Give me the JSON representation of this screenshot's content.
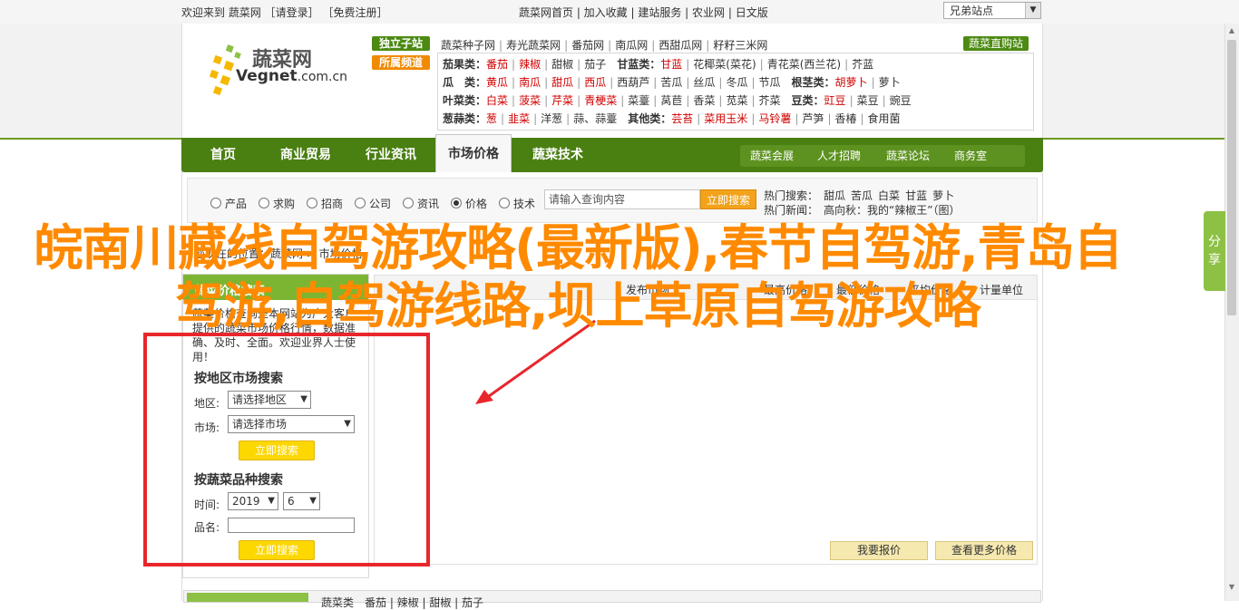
{
  "topbar": {
    "welcome": "欢迎来到 蔬菜网 ［请登录］ ［免费注册］",
    "links": "蔬菜网首页 | 加入收藏 | 建站服务 | 农业网 | 日文版",
    "select_value": "兄弟站点"
  },
  "logo": {
    "cn": "蔬菜网",
    "en": "Vegnet",
    "domain": ".com.cn",
    "reg": "®"
  },
  "tags": {
    "seed": "独立子站",
    "channel": "所属频道",
    "direct": "蔬菜直购站"
  },
  "seed_sites": [
    "蔬菜种子网",
    "寿光蔬菜网",
    "番茄网",
    "南瓜网",
    "西甜瓜网",
    "籽籽三米网"
  ],
  "categories": [
    {
      "label": "茄果类：",
      "items": [
        {
          "t": "番茄",
          "r": true
        },
        {
          "t": "辣椒",
          "r": true
        },
        {
          "t": "甜椒",
          "r": false
        },
        {
          "t": "茄子",
          "r": false
        }
      ],
      "label2": "甘蓝类：",
      "items2": [
        {
          "t": "甘蓝",
          "r": true
        },
        {
          "t": "花椰菜(菜花)",
          "r": false
        },
        {
          "t": "青花菜(西兰花)",
          "r": false
        },
        {
          "t": "芥蓝",
          "r": false
        }
      ]
    },
    {
      "label": "瓜　类：",
      "items": [
        {
          "t": "黄瓜",
          "r": true
        },
        {
          "t": "南瓜",
          "r": true
        },
        {
          "t": "甜瓜",
          "r": true
        },
        {
          "t": "西瓜",
          "r": true
        },
        {
          "t": "西葫芦",
          "r": false
        },
        {
          "t": "苦瓜",
          "r": false
        },
        {
          "t": "丝瓜",
          "r": false
        },
        {
          "t": "冬瓜",
          "r": false
        },
        {
          "t": "节瓜",
          "r": false
        }
      ],
      "label2": "根茎类：",
      "items2": [
        {
          "t": "胡萝卜",
          "r": true
        },
        {
          "t": "萝卜",
          "r": false
        }
      ]
    },
    {
      "label": "叶菜类：",
      "items": [
        {
          "t": "白菜",
          "r": true
        },
        {
          "t": "菠菜",
          "r": true
        },
        {
          "t": "芹菜",
          "r": true
        },
        {
          "t": "青梗菜",
          "r": true
        },
        {
          "t": "菜薹",
          "r": false
        },
        {
          "t": "莴苣",
          "r": false
        },
        {
          "t": "香菜",
          "r": false
        },
        {
          "t": "苋菜",
          "r": false
        },
        {
          "t": "芥菜",
          "r": false
        }
      ],
      "label2": "豆类：",
      "items2": [
        {
          "t": "豇豆",
          "r": true
        },
        {
          "t": "菜豆",
          "r": false
        },
        {
          "t": "豌豆",
          "r": false
        }
      ]
    },
    {
      "label": "葱蒜类：",
      "items": [
        {
          "t": "葱",
          "r": true
        },
        {
          "t": "韭菜",
          "r": true
        },
        {
          "t": "洋葱",
          "r": false
        },
        {
          "t": "蒜、蒜薹",
          "r": false
        }
      ],
      "label2": "其他类：",
      "items2": [
        {
          "t": "芸苔",
          "r": true
        },
        {
          "t": "菜用玉米",
          "r": true
        },
        {
          "t": "马铃薯",
          "r": true
        },
        {
          "t": "芦笋",
          "r": false
        },
        {
          "t": "香椿",
          "r": false
        },
        {
          "t": "食用菌",
          "r": false
        }
      ]
    }
  ],
  "nav": {
    "items": [
      "首页",
      "商业贸易",
      "行业资讯",
      "市场价格",
      "蔬菜技术"
    ],
    "active_index": 3,
    "sub": [
      "蔬菜会展",
      "人才招聘",
      "蔬菜论坛",
      "商务室"
    ]
  },
  "search": {
    "radios": [
      "产品",
      "求购",
      "招商",
      "公司",
      "资讯",
      "价格",
      "技术"
    ],
    "checked_index": 5,
    "placeholder": "请输入查询内容",
    "button": "立即搜索",
    "hot_label": "热门搜索：",
    "hot_items": [
      "甜瓜",
      "苦瓜",
      "白菜",
      "甘蓝",
      "萝卜"
    ],
    "new_label": "热门新闻：",
    "new_text": "高向秋：我的“辣椒王”（图）"
  },
  "crumb": "您现在的位置：蔬菜网 > 市场价格",
  "left_panel": {
    "title": "蔬菜价格搜索",
    "intro": "蔬菜价格查询是本网站为广大客户提供的蔬菜市场价格行情，数据准确、及时、全面。欢迎业界人士使用！",
    "region_heading": "按地区市场搜索",
    "region_label": "地区:",
    "region_value": "请选择地区",
    "market_label": "市场:",
    "market_value": "请选择市场",
    "button1": "立即搜索",
    "variety_heading": "按蔬菜品种搜索",
    "time_label": "时间:",
    "year": "2019",
    "month": "6",
    "name_label": "品名:",
    "button2": "立即搜索"
  },
  "right_head": {
    "col_publish": "发布市场",
    "col_price": "最高价格",
    "col_low": "最低价格",
    "col_avg": "平均价格",
    "col_unit": "计量单位"
  },
  "right_buttons": {
    "report": "我要报价",
    "more": "查看更多价格"
  },
  "bottom": {
    "row": "蔬菜类　番茄 | 辣椒 | 甜椒 | 茄子"
  },
  "share": "分享",
  "overlay_title": "皖南川藏线自驾游攻略(最新版),春节自驾游,青岛自驾游,自驾游线路,坝上草原自驾游攻略",
  "colors": {
    "brand_green": "#4a7f12",
    "accent_orange": "#ff8a00",
    "annotation_red": "#e8262b"
  }
}
